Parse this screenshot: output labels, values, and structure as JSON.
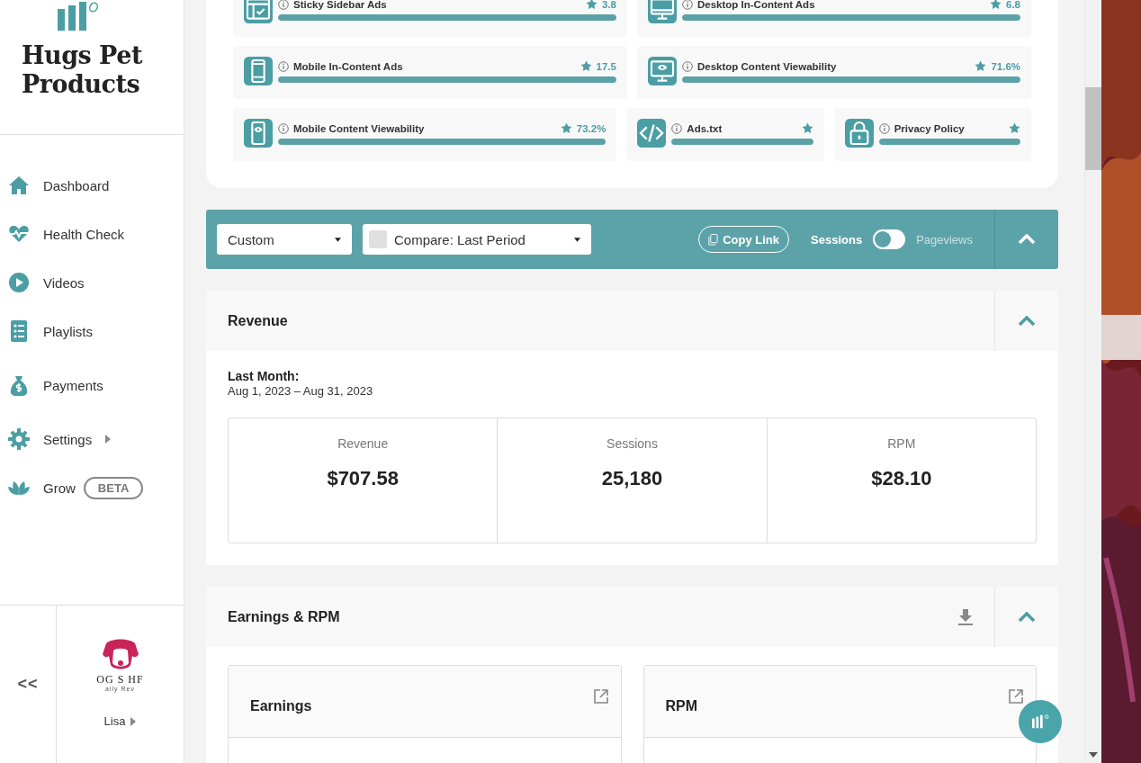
{
  "sidebar": {
    "brand": "Hugs Pet Products",
    "items": [
      {
        "kind": "home",
        "label": "Dashboard",
        "submenu": false
      },
      {
        "kind": "heart",
        "label": "Health Check",
        "submenu": false
      },
      {
        "kind": "play",
        "label": "Videos",
        "submenu": false
      },
      {
        "kind": "list",
        "label": "Playlists",
        "submenu": false
      },
      {
        "kind": "money",
        "label": "Payments",
        "submenu": false
      },
      {
        "kind": "gear",
        "label": "Settings",
        "submenu": true
      },
      {
        "kind": "leaf",
        "label": "Grow",
        "submenu": false,
        "badge": "BETA"
      }
    ],
    "collapse": "<<",
    "account": {
      "logo_text": "OG S HF",
      "logo_subtext": "ally Rev",
      "user": "Lisa"
    }
  },
  "ad_scores": [
    [
      {
        "kind": "sidebar",
        "title": "Sticky Sidebar Ads",
        "value": "3.8",
        "level": 1
      },
      {
        "kind": "desktop",
        "title": "Desktop In-Content Ads",
        "value": "6.8",
        "level": 1
      }
    ],
    [
      {
        "kind": "mobile",
        "title": "Mobile In-Content Ads",
        "value": "17.5",
        "level": 1
      },
      {
        "kind": "desktop-eye",
        "title": "Desktop Content Viewability",
        "value": "71.6%",
        "level": 1
      }
    ],
    [
      {
        "kind": "mobile-eye",
        "title": "Mobile Content Viewability",
        "value": "73.2%",
        "level": 1
      },
      {
        "kind": "code",
        "title": "Ads.txt",
        "level": 1
      },
      {
        "kind": "lock",
        "title": "Privacy Policy",
        "level": 1
      }
    ]
  ],
  "filter_bar": {
    "range": "Custom",
    "compare": "Compare: Last Period",
    "compare_checked": false,
    "copy_link": "Copy Link",
    "toggle": {
      "left": "Sessions",
      "right": "Pageviews",
      "right_selected": false
    }
  },
  "revenue": {
    "title": "Revenue",
    "period_label": "Last Month:",
    "period": "Aug 1, 2023 – Aug 31, 2023",
    "stats": [
      {
        "label": "Revenue",
        "value": "$707.58"
      },
      {
        "label": "Sessions",
        "value": "25,180"
      },
      {
        "label": "RPM",
        "value": "$28.10"
      }
    ]
  },
  "earnings_rpm": {
    "title": "Earnings & RPM",
    "charts": [
      {
        "title": "Earnings"
      },
      {
        "title": "RPM"
      }
    ]
  }
}
